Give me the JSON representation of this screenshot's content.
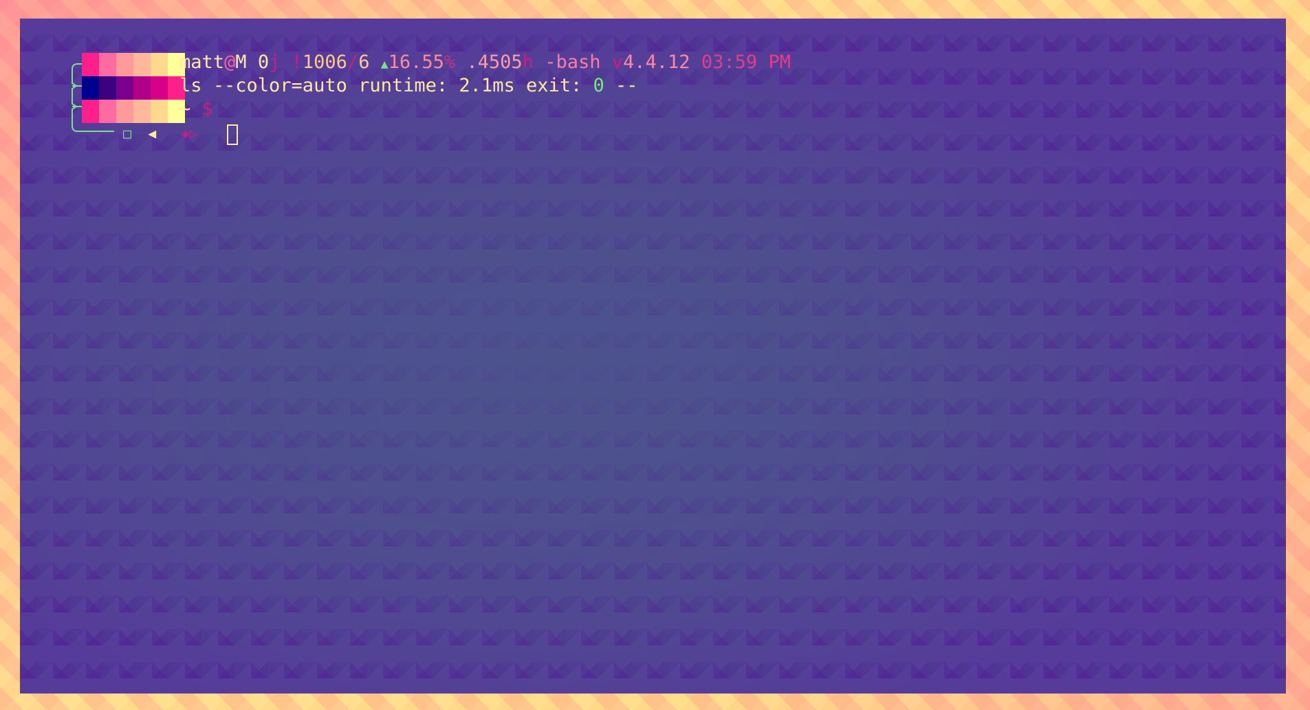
{
  "prompt": {
    "user": "matt",
    "at": "@",
    "host": "M",
    "jobs": "0",
    "sep1": "j",
    "hist_bang": "!",
    "hist_num": "1006",
    "hist_slash": "/",
    "hist_cmd": "6",
    "trend_icon": "triangle-up-icon",
    "trend_glyph": "▲",
    "cpu": "16.55",
    "pct_sign": "%",
    "load": ".4505",
    "load_unit": "h",
    "shell": "-bash",
    "ver_prefix": "v",
    "version": "4.4.12",
    "time": "03:59 PM"
  },
  "last_command": {
    "command": "ls --color=auto",
    "runtime_label": "runtime:",
    "runtime": "2.1ms",
    "exit_label": "exit:",
    "exit_code": "0",
    "trail": "--"
  },
  "cwd": {
    "path": "~",
    "symbol": "$"
  },
  "input_line": {
    "square_glyph": "□",
    "left_glyph": "◀",
    "diamond_glyph": "◈▷"
  },
  "colors": {
    "background": "#563b9a",
    "frame": "#ffd787",
    "text": "#ffe8a0",
    "accent": "#d01c82",
    "ok": "#7fe08a"
  },
  "palette_rows": [
    [
      "#ff1f8a",
      "#ff6aa0",
      "#ff9a9a",
      "#ffb89a",
      "#ffd890",
      "#ffff9a"
    ],
    [
      "#00008f",
      "#3a0080",
      "#7a0090",
      "#b0008a",
      "#d8008a",
      "#ff1f8a"
    ],
    [
      "#ff1f8a",
      "#ff6aa0",
      "#ff9a9a",
      "#ffb89a",
      "#ffd890",
      "#ffff9a"
    ]
  ]
}
